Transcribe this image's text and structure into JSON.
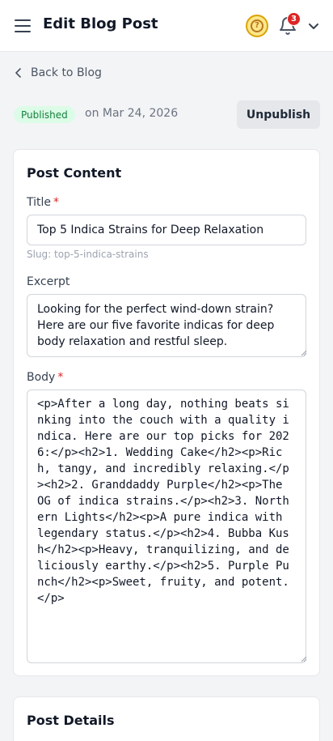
{
  "header": {
    "title": "Edit Blog Post",
    "help_icon": "help-circle-icon",
    "notification_icon": "bell-icon",
    "notification_count": "3",
    "menu_icon": "hamburger-icon",
    "dropdown_icon": "chevron-down-icon"
  },
  "nav": {
    "back_label": "Back to Blog"
  },
  "status": {
    "badge": "Published",
    "date_text": "on Mar 24, 2026",
    "unpublish_label": "Unpublish"
  },
  "post_content": {
    "heading": "Post Content",
    "title_label": "Title",
    "title_value": "Top 5 Indica Strains for Deep Relaxation",
    "slug_text": "Slug: top-5-indica-strains",
    "excerpt_label": "Excerpt",
    "excerpt_value": "Looking for the perfect wind-down strain? Here are our five favorite indicas for deep body relaxation and restful sleep.",
    "body_label": "Body",
    "body_value": "<p>After a long day, nothing beats sinking into the couch with a quality indica. Here are our top picks for 2026:</p><h2>1. Wedding Cake</h2><p>Rich, tangy, and incredibly relaxing.</p><h2>2. Granddaddy Purple</h2><p>The OG of indica strains.</p><h2>3. Northern Lights</h2><p>A pure indica with legendary status.</p><h2>4. Bubba Kush</h2><p>Heavy, tranquilizing, and deliciously earthy.</p><h2>5. Purple Punch</h2><p>Sweet, fruity, and potent.</p>",
    "required_marker": "*"
  },
  "post_details": {
    "heading": "Post Details"
  },
  "colors": {
    "accent_yellow": "#fde68a",
    "badge_red": "#dc2626",
    "published_green": "#15803d"
  }
}
